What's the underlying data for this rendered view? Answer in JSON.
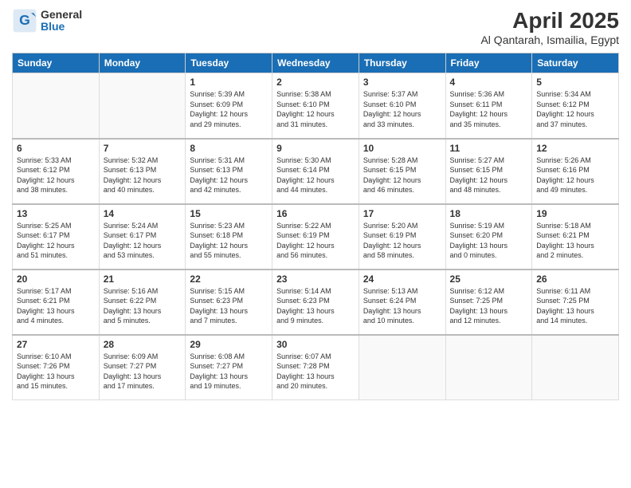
{
  "header": {
    "logo_general": "General",
    "logo_blue": "Blue",
    "month_title": "April 2025",
    "location": "Al Qantarah, Ismailia, Egypt"
  },
  "weekdays": [
    "Sunday",
    "Monday",
    "Tuesday",
    "Wednesday",
    "Thursday",
    "Friday",
    "Saturday"
  ],
  "weeks": [
    [
      {
        "day": "",
        "info": ""
      },
      {
        "day": "",
        "info": ""
      },
      {
        "day": "1",
        "info": "Sunrise: 5:39 AM\nSunset: 6:09 PM\nDaylight: 12 hours\nand 29 minutes."
      },
      {
        "day": "2",
        "info": "Sunrise: 5:38 AM\nSunset: 6:10 PM\nDaylight: 12 hours\nand 31 minutes."
      },
      {
        "day": "3",
        "info": "Sunrise: 5:37 AM\nSunset: 6:10 PM\nDaylight: 12 hours\nand 33 minutes."
      },
      {
        "day": "4",
        "info": "Sunrise: 5:36 AM\nSunset: 6:11 PM\nDaylight: 12 hours\nand 35 minutes."
      },
      {
        "day": "5",
        "info": "Sunrise: 5:34 AM\nSunset: 6:12 PM\nDaylight: 12 hours\nand 37 minutes."
      }
    ],
    [
      {
        "day": "6",
        "info": "Sunrise: 5:33 AM\nSunset: 6:12 PM\nDaylight: 12 hours\nand 38 minutes."
      },
      {
        "day": "7",
        "info": "Sunrise: 5:32 AM\nSunset: 6:13 PM\nDaylight: 12 hours\nand 40 minutes."
      },
      {
        "day": "8",
        "info": "Sunrise: 5:31 AM\nSunset: 6:13 PM\nDaylight: 12 hours\nand 42 minutes."
      },
      {
        "day": "9",
        "info": "Sunrise: 5:30 AM\nSunset: 6:14 PM\nDaylight: 12 hours\nand 44 minutes."
      },
      {
        "day": "10",
        "info": "Sunrise: 5:28 AM\nSunset: 6:15 PM\nDaylight: 12 hours\nand 46 minutes."
      },
      {
        "day": "11",
        "info": "Sunrise: 5:27 AM\nSunset: 6:15 PM\nDaylight: 12 hours\nand 48 minutes."
      },
      {
        "day": "12",
        "info": "Sunrise: 5:26 AM\nSunset: 6:16 PM\nDaylight: 12 hours\nand 49 minutes."
      }
    ],
    [
      {
        "day": "13",
        "info": "Sunrise: 5:25 AM\nSunset: 6:17 PM\nDaylight: 12 hours\nand 51 minutes."
      },
      {
        "day": "14",
        "info": "Sunrise: 5:24 AM\nSunset: 6:17 PM\nDaylight: 12 hours\nand 53 minutes."
      },
      {
        "day": "15",
        "info": "Sunrise: 5:23 AM\nSunset: 6:18 PM\nDaylight: 12 hours\nand 55 minutes."
      },
      {
        "day": "16",
        "info": "Sunrise: 5:22 AM\nSunset: 6:19 PM\nDaylight: 12 hours\nand 56 minutes."
      },
      {
        "day": "17",
        "info": "Sunrise: 5:20 AM\nSunset: 6:19 PM\nDaylight: 12 hours\nand 58 minutes."
      },
      {
        "day": "18",
        "info": "Sunrise: 5:19 AM\nSunset: 6:20 PM\nDaylight: 13 hours\nand 0 minutes."
      },
      {
        "day": "19",
        "info": "Sunrise: 5:18 AM\nSunset: 6:21 PM\nDaylight: 13 hours\nand 2 minutes."
      }
    ],
    [
      {
        "day": "20",
        "info": "Sunrise: 5:17 AM\nSunset: 6:21 PM\nDaylight: 13 hours\nand 4 minutes."
      },
      {
        "day": "21",
        "info": "Sunrise: 5:16 AM\nSunset: 6:22 PM\nDaylight: 13 hours\nand 5 minutes."
      },
      {
        "day": "22",
        "info": "Sunrise: 5:15 AM\nSunset: 6:23 PM\nDaylight: 13 hours\nand 7 minutes."
      },
      {
        "day": "23",
        "info": "Sunrise: 5:14 AM\nSunset: 6:23 PM\nDaylight: 13 hours\nand 9 minutes."
      },
      {
        "day": "24",
        "info": "Sunrise: 5:13 AM\nSunset: 6:24 PM\nDaylight: 13 hours\nand 10 minutes."
      },
      {
        "day": "25",
        "info": "Sunrise: 6:12 AM\nSunset: 7:25 PM\nDaylight: 13 hours\nand 12 minutes."
      },
      {
        "day": "26",
        "info": "Sunrise: 6:11 AM\nSunset: 7:25 PM\nDaylight: 13 hours\nand 14 minutes."
      }
    ],
    [
      {
        "day": "27",
        "info": "Sunrise: 6:10 AM\nSunset: 7:26 PM\nDaylight: 13 hours\nand 15 minutes."
      },
      {
        "day": "28",
        "info": "Sunrise: 6:09 AM\nSunset: 7:27 PM\nDaylight: 13 hours\nand 17 minutes."
      },
      {
        "day": "29",
        "info": "Sunrise: 6:08 AM\nSunset: 7:27 PM\nDaylight: 13 hours\nand 19 minutes."
      },
      {
        "day": "30",
        "info": "Sunrise: 6:07 AM\nSunset: 7:28 PM\nDaylight: 13 hours\nand 20 minutes."
      },
      {
        "day": "",
        "info": ""
      },
      {
        "day": "",
        "info": ""
      },
      {
        "day": "",
        "info": ""
      }
    ]
  ]
}
